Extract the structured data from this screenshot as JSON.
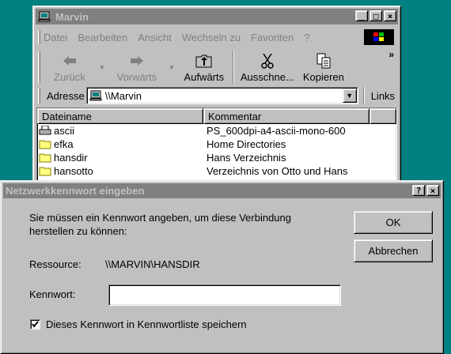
{
  "explorer": {
    "title": "Marvin",
    "menu": [
      {
        "label": "Datei"
      },
      {
        "label": "Bearbeiten"
      },
      {
        "label": "Ansicht"
      },
      {
        "label": "Wechseln zu"
      },
      {
        "label": "Favoriten"
      },
      {
        "label": "?"
      }
    ],
    "toolbar": {
      "back": "Zurück",
      "forward": "Vorwärts",
      "up": "Aufwärts",
      "cut": "Ausschne...",
      "copy": "Kopieren",
      "more": "»"
    },
    "address": {
      "label": "Adresse",
      "value": "\\\\Marvin",
      "links": "Links"
    },
    "columns": [
      "Dateiname",
      "Kommentar"
    ],
    "files": [
      {
        "name": "ascii",
        "comment": "PS_600dpi-a4-ascii-mono-600",
        "icon": "printer-icon"
      },
      {
        "name": "efka",
        "comment": "Home Directories",
        "icon": "folder-icon"
      },
      {
        "name": "hansdir",
        "comment": "Hans Verzeichnis",
        "icon": "folder-icon"
      },
      {
        "name": "hansotto",
        "comment": "Verzeichnis von Otto und Hans",
        "icon": "folder-icon"
      }
    ],
    "window_buttons": {
      "minimize": "_",
      "maximize": "□",
      "close": "×"
    }
  },
  "dialog": {
    "title": "Netzwerkkennwort eingeben",
    "help": "?",
    "close": "×",
    "message_line1": "Sie müssen ein Kennwort angeben, um diese Verbindung",
    "message_line2": "herstellen zu können:",
    "resource_label": "Ressource:",
    "resource_value": "\\\\MARVIN\\HANSDIR",
    "password_label": "Kennwort:",
    "password_value": "",
    "save_checkbox_label": "Dieses Kennwort in Kennwortliste speichern",
    "save_checked": true,
    "ok": "OK",
    "cancel": "Abbrechen"
  },
  "colors": {
    "desktop": "#008080",
    "face": "#c0c0c0",
    "inactive_title": "#808080"
  }
}
